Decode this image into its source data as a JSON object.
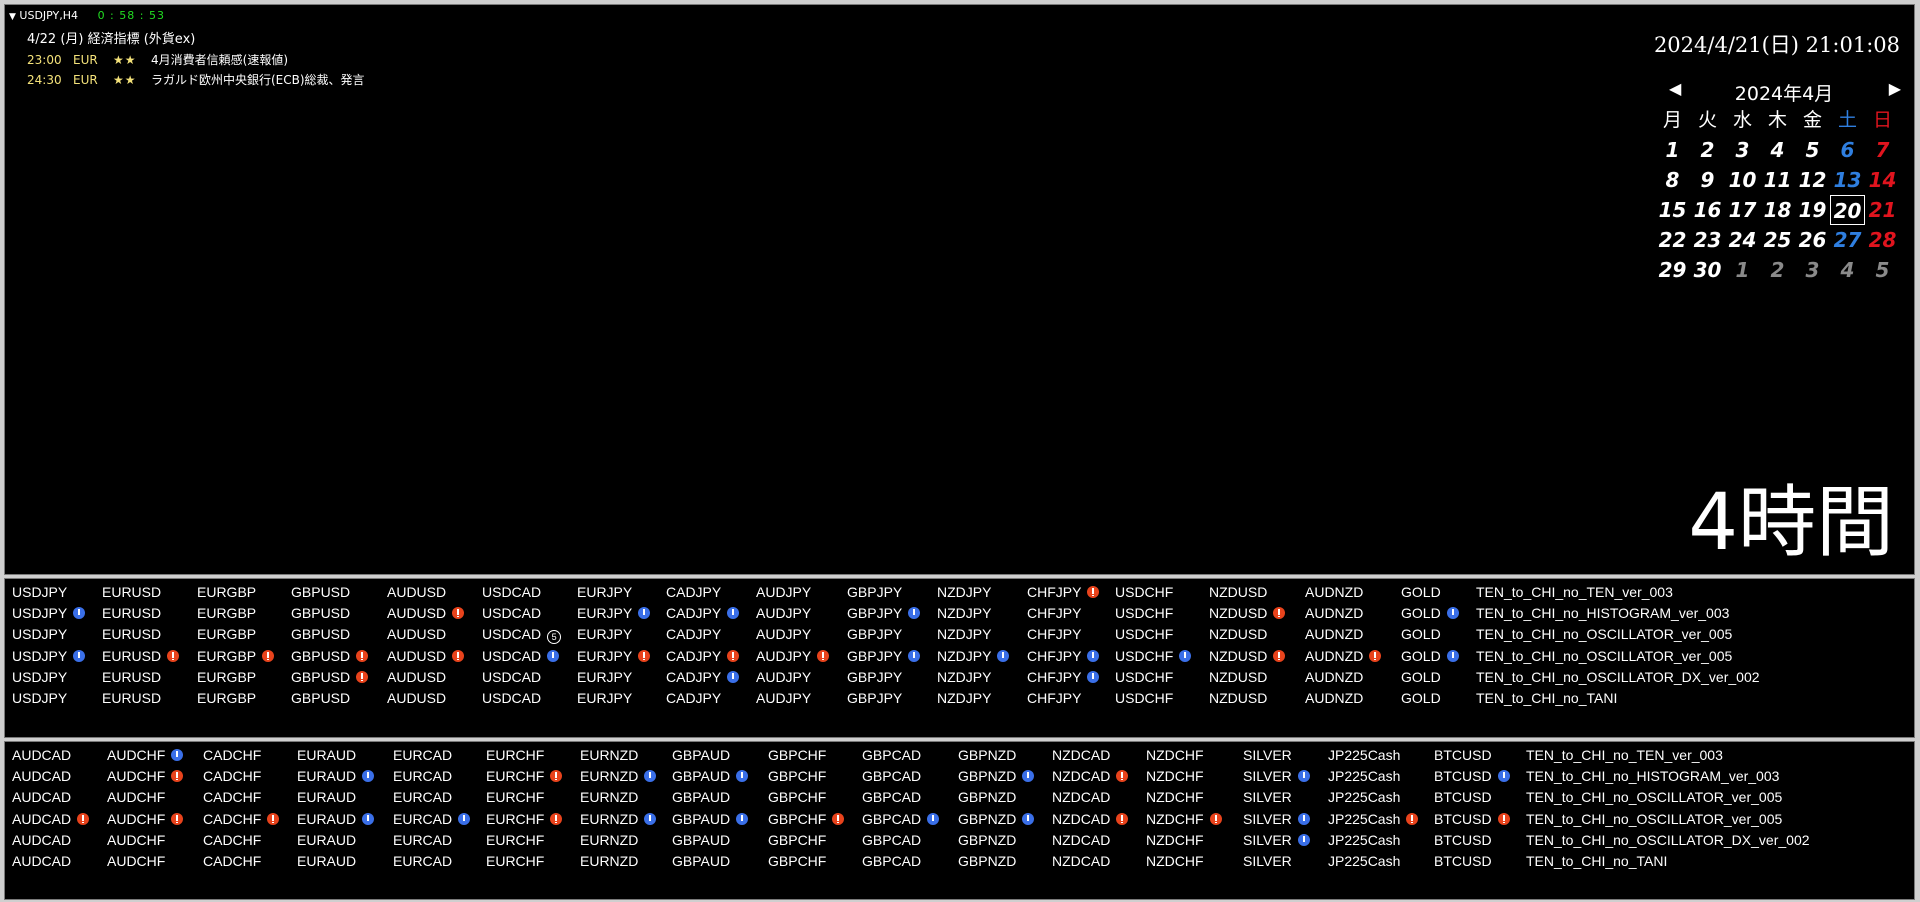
{
  "header": {
    "symbol": "USDJPY,H4",
    "countdown": "0 : 58 : 53"
  },
  "events": {
    "date_line": "4/22 (月) 経済指標 (外貨ex)",
    "items": [
      {
        "time": "23:00",
        "currency": "EUR",
        "stars": "★★",
        "text": "4月消費者信頼感(速報値)"
      },
      {
        "time": "24:30",
        "currency": "EUR",
        "stars": "★★",
        "text": "ラガルド欧州中央銀行(ECB)総裁、発言"
      }
    ]
  },
  "datetime": "2024/4/21(日) 21:01:08",
  "calendar": {
    "title": "2024年4月",
    "prev": "◀",
    "next": "▶",
    "weekdays": [
      "月",
      "火",
      "水",
      "木",
      "金",
      "土",
      "日"
    ],
    "weeks": [
      [
        "1",
        "2",
        "3",
        "4",
        "5",
        "6",
        "7"
      ],
      [
        "8",
        "9",
        "10",
        "11",
        "12",
        "13",
        "14"
      ],
      [
        "15",
        "16",
        "17",
        "18",
        "19",
        "20",
        "21"
      ],
      [
        "22",
        "23",
        "24",
        "25",
        "26",
        "27",
        "28"
      ],
      [
        "29",
        "30",
        "1",
        "2",
        "3",
        "4",
        "5"
      ]
    ],
    "today": "20",
    "colors": {
      "saturday": "#2f7fe0",
      "sunday": "#e0141e",
      "other_month": "#8a8a8a"
    }
  },
  "timeframe_label": "4時間",
  "panel1": {
    "rows": [
      [
        [
          "USDJPY",
          ""
        ],
        [
          "EURUSD",
          ""
        ],
        [
          "EURGBP",
          ""
        ],
        [
          "GBPUSD",
          ""
        ],
        [
          "AUDUSD",
          ""
        ],
        [
          "USDCAD",
          ""
        ],
        [
          "EURJPY",
          ""
        ],
        [
          "CADJPY",
          ""
        ],
        [
          "AUDJPY",
          ""
        ],
        [
          "GBPJPY",
          ""
        ],
        [
          "NZDJPY",
          ""
        ],
        [
          "CHFJPY",
          "red"
        ],
        [
          "USDCHF",
          ""
        ],
        [
          "NZDUSD",
          ""
        ],
        [
          "AUDNZD",
          ""
        ],
        [
          "GOLD",
          ""
        ],
        [
          "TEN_to_CHI_no_TEN_ver_003",
          ""
        ]
      ],
      [
        [
          "USDJPY",
          "blue"
        ],
        [
          "EURUSD",
          ""
        ],
        [
          "EURGBP",
          ""
        ],
        [
          "GBPUSD",
          ""
        ],
        [
          "AUDUSD",
          "red"
        ],
        [
          "USDCAD",
          ""
        ],
        [
          "EURJPY",
          "blue"
        ],
        [
          "CADJPY",
          "blue"
        ],
        [
          "AUDJPY",
          ""
        ],
        [
          "GBPJPY",
          "blue"
        ],
        [
          "NZDJPY",
          ""
        ],
        [
          "CHFJPY",
          ""
        ],
        [
          "USDCHF",
          ""
        ],
        [
          "NZDUSD",
          "red"
        ],
        [
          "AUDNZD",
          ""
        ],
        [
          "GOLD",
          "blue"
        ],
        [
          "TEN_to_CHI_no_HISTOGRAM_ver_003",
          ""
        ]
      ],
      [
        [
          "USDJPY",
          ""
        ],
        [
          "EURUSD",
          ""
        ],
        [
          "EURGBP",
          ""
        ],
        [
          "GBPUSD",
          ""
        ],
        [
          "AUDUSD",
          ""
        ],
        [
          "USDCAD",
          "circ5"
        ],
        [
          "EURJPY",
          ""
        ],
        [
          "CADJPY",
          ""
        ],
        [
          "AUDJPY",
          ""
        ],
        [
          "GBPJPY",
          ""
        ],
        [
          "NZDJPY",
          ""
        ],
        [
          "CHFJPY",
          ""
        ],
        [
          "USDCHF",
          ""
        ],
        [
          "NZDUSD",
          ""
        ],
        [
          "AUDNZD",
          ""
        ],
        [
          "GOLD",
          ""
        ],
        [
          "TEN_to_CHI_no_OSCILLATOR_ver_005",
          ""
        ]
      ],
      [
        [
          "USDJPY",
          "blue"
        ],
        [
          "EURUSD",
          "red"
        ],
        [
          "EURGBP",
          "red"
        ],
        [
          "GBPUSD",
          "red"
        ],
        [
          "AUDUSD",
          "red"
        ],
        [
          "USDCAD",
          "blue"
        ],
        [
          "EURJPY",
          "red"
        ],
        [
          "CADJPY",
          "red"
        ],
        [
          "AUDJPY",
          "red"
        ],
        [
          "GBPJPY",
          "blue"
        ],
        [
          "NZDJPY",
          "blue"
        ],
        [
          "CHFJPY",
          "blue"
        ],
        [
          "USDCHF",
          "blue"
        ],
        [
          "NZDUSD",
          "red"
        ],
        [
          "AUDNZD",
          "red"
        ],
        [
          "GOLD",
          "blue"
        ],
        [
          "TEN_to_CHI_no_OSCILLATOR_ver_005",
          ""
        ]
      ],
      [
        [
          "USDJPY",
          ""
        ],
        [
          "EURUSD",
          ""
        ],
        [
          "EURGBP",
          ""
        ],
        [
          "GBPUSD",
          "red"
        ],
        [
          "AUDUSD",
          ""
        ],
        [
          "USDCAD",
          ""
        ],
        [
          "EURJPY",
          ""
        ],
        [
          "CADJPY",
          "blue"
        ],
        [
          "AUDJPY",
          ""
        ],
        [
          "GBPJPY",
          ""
        ],
        [
          "NZDJPY",
          ""
        ],
        [
          "CHFJPY",
          "blue"
        ],
        [
          "USDCHF",
          ""
        ],
        [
          "NZDUSD",
          ""
        ],
        [
          "AUDNZD",
          ""
        ],
        [
          "GOLD",
          ""
        ],
        [
          "TEN_to_CHI_no_OSCILLATOR_DX_ver_002",
          ""
        ]
      ],
      [
        [
          "USDJPY",
          ""
        ],
        [
          "EURUSD",
          ""
        ],
        [
          "EURGBP",
          ""
        ],
        [
          "GBPUSD",
          ""
        ],
        [
          "AUDUSD",
          ""
        ],
        [
          "USDCAD",
          ""
        ],
        [
          "EURJPY",
          ""
        ],
        [
          "CADJPY",
          ""
        ],
        [
          "AUDJPY",
          ""
        ],
        [
          "GBPJPY",
          ""
        ],
        [
          "NZDJPY",
          ""
        ],
        [
          "CHFJPY",
          ""
        ],
        [
          "USDCHF",
          ""
        ],
        [
          "NZDUSD",
          ""
        ],
        [
          "AUDNZD",
          ""
        ],
        [
          "GOLD",
          ""
        ],
        [
          "TEN_to_CHI_no_TANI",
          ""
        ]
      ]
    ]
  },
  "panel2": {
    "rows": [
      [
        [
          "AUDCAD",
          ""
        ],
        [
          "AUDCHF",
          "blue"
        ],
        [
          "CADCHF",
          ""
        ],
        [
          "EURAUD",
          ""
        ],
        [
          "EURCAD",
          ""
        ],
        [
          "EURCHF",
          ""
        ],
        [
          "EURNZD",
          ""
        ],
        [
          "GBPAUD",
          ""
        ],
        [
          "GBPCHF",
          ""
        ],
        [
          "GBPCAD",
          ""
        ],
        [
          "GBPNZD",
          ""
        ],
        [
          "NZDCAD",
          ""
        ],
        [
          "NZDCHF",
          ""
        ],
        [
          "SILVER",
          ""
        ],
        [
          "JP225Cash",
          ""
        ],
        [
          "BTCUSD",
          ""
        ],
        [
          "TEN_to_CHI_no_TEN_ver_003",
          ""
        ]
      ],
      [
        [
          "AUDCAD",
          ""
        ],
        [
          "AUDCHF",
          "red"
        ],
        [
          "CADCHF",
          ""
        ],
        [
          "EURAUD",
          "blue"
        ],
        [
          "EURCAD",
          ""
        ],
        [
          "EURCHF",
          "red"
        ],
        [
          "EURNZD",
          "blue"
        ],
        [
          "GBPAUD",
          "blue"
        ],
        [
          "GBPCHF",
          ""
        ],
        [
          "GBPCAD",
          ""
        ],
        [
          "GBPNZD",
          "blue"
        ],
        [
          "NZDCAD",
          "red"
        ],
        [
          "NZDCHF",
          ""
        ],
        [
          "SILVER",
          "blue"
        ],
        [
          "JP225Cash",
          ""
        ],
        [
          "BTCUSD",
          "blue"
        ],
        [
          "TEN_to_CHI_no_HISTOGRAM_ver_003",
          ""
        ]
      ],
      [
        [
          "AUDCAD",
          ""
        ],
        [
          "AUDCHF",
          ""
        ],
        [
          "CADCHF",
          ""
        ],
        [
          "EURAUD",
          ""
        ],
        [
          "EURCAD",
          ""
        ],
        [
          "EURCHF",
          ""
        ],
        [
          "EURNZD",
          ""
        ],
        [
          "GBPAUD",
          ""
        ],
        [
          "GBPCHF",
          ""
        ],
        [
          "GBPCAD",
          ""
        ],
        [
          "GBPNZD",
          ""
        ],
        [
          "NZDCAD",
          ""
        ],
        [
          "NZDCHF",
          ""
        ],
        [
          "SILVER",
          ""
        ],
        [
          "JP225Cash",
          ""
        ],
        [
          "BTCUSD",
          ""
        ],
        [
          "TEN_to_CHI_no_OSCILLATOR_ver_005",
          ""
        ]
      ],
      [
        [
          "AUDCAD",
          "red"
        ],
        [
          "AUDCHF",
          "red"
        ],
        [
          "CADCHF",
          "red"
        ],
        [
          "EURAUD",
          "blue"
        ],
        [
          "EURCAD",
          "blue"
        ],
        [
          "EURCHF",
          "red"
        ],
        [
          "EURNZD",
          "blue"
        ],
        [
          "GBPAUD",
          "blue"
        ],
        [
          "GBPCHF",
          "red"
        ],
        [
          "GBPCAD",
          "blue"
        ],
        [
          "GBPNZD",
          "blue"
        ],
        [
          "NZDCAD",
          "red"
        ],
        [
          "NZDCHF",
          "red"
        ],
        [
          "SILVER",
          "blue"
        ],
        [
          "JP225Cash",
          "red"
        ],
        [
          "BTCUSD",
          "red"
        ],
        [
          "TEN_to_CHI_no_OSCILLATOR_ver_005",
          ""
        ]
      ],
      [
        [
          "AUDCAD",
          ""
        ],
        [
          "AUDCHF",
          ""
        ],
        [
          "CADCHF",
          ""
        ],
        [
          "EURAUD",
          ""
        ],
        [
          "EURCAD",
          ""
        ],
        [
          "EURCHF",
          ""
        ],
        [
          "EURNZD",
          ""
        ],
        [
          "GBPAUD",
          ""
        ],
        [
          "GBPCHF",
          ""
        ],
        [
          "GBPCAD",
          ""
        ],
        [
          "GBPNZD",
          ""
        ],
        [
          "NZDCAD",
          ""
        ],
        [
          "NZDCHF",
          ""
        ],
        [
          "SILVER",
          "blue"
        ],
        [
          "JP225Cash",
          ""
        ],
        [
          "BTCUSD",
          ""
        ],
        [
          "TEN_to_CHI_no_OSCILLATOR_DX_ver_002",
          ""
        ]
      ],
      [
        [
          "AUDCAD",
          ""
        ],
        [
          "AUDCHF",
          ""
        ],
        [
          "CADCHF",
          ""
        ],
        [
          "EURAUD",
          ""
        ],
        [
          "EURCAD",
          ""
        ],
        [
          "EURCHF",
          ""
        ],
        [
          "EURNZD",
          ""
        ],
        [
          "GBPAUD",
          ""
        ],
        [
          "GBPCHF",
          ""
        ],
        [
          "GBPCAD",
          ""
        ],
        [
          "GBPNZD",
          ""
        ],
        [
          "NZDCAD",
          ""
        ],
        [
          "NZDCHF",
          ""
        ],
        [
          "SILVER",
          ""
        ],
        [
          "JP225Cash",
          ""
        ],
        [
          "BTCUSD",
          ""
        ],
        [
          "TEN_to_CHI_no_TANI",
          ""
        ]
      ]
    ]
  }
}
